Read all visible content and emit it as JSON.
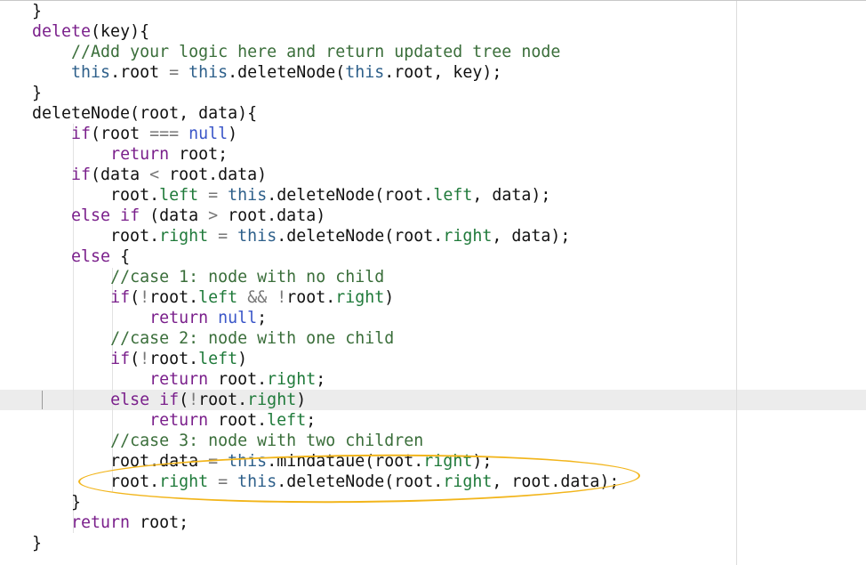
{
  "editor": {
    "lines": [
      [
        {
          "t": "}",
          "c": ""
        }
      ],
      [
        {
          "t": "delete",
          "c": "kw"
        },
        {
          "t": "(key){",
          "c": ""
        }
      ],
      [
        {
          "t": "    ",
          "c": ""
        },
        {
          "t": "//Add your logic here and return updated tree node",
          "c": "cm"
        }
      ],
      [
        {
          "t": "    ",
          "c": ""
        },
        {
          "t": "this",
          "c": "th"
        },
        {
          "t": ".root ",
          "c": ""
        },
        {
          "t": "=",
          "c": "op"
        },
        {
          "t": " ",
          "c": ""
        },
        {
          "t": "this",
          "c": "th"
        },
        {
          "t": ".deleteNode(",
          "c": ""
        },
        {
          "t": "this",
          "c": "th"
        },
        {
          "t": ".root, key);",
          "c": ""
        }
      ],
      [
        {
          "t": "}",
          "c": ""
        }
      ],
      [
        {
          "t": "deleteNode(root, data){",
          "c": ""
        }
      ],
      [
        {
          "t": "    ",
          "c": ""
        },
        {
          "t": "if",
          "c": "kw"
        },
        {
          "t": "(root ",
          "c": ""
        },
        {
          "t": "===",
          "c": "op"
        },
        {
          "t": " ",
          "c": ""
        },
        {
          "t": "null",
          "c": "kb"
        },
        {
          "t": ")",
          "c": ""
        }
      ],
      [
        {
          "t": "        ",
          "c": ""
        },
        {
          "t": "return",
          "c": "kw"
        },
        {
          "t": " root;",
          "c": ""
        }
      ],
      [
        {
          "t": "    ",
          "c": ""
        },
        {
          "t": "if",
          "c": "kw"
        },
        {
          "t": "(data ",
          "c": ""
        },
        {
          "t": "<",
          "c": "op"
        },
        {
          "t": " root.data)",
          "c": ""
        }
      ],
      [
        {
          "t": "        root.",
          "c": ""
        },
        {
          "t": "left",
          "c": "pr"
        },
        {
          "t": " ",
          "c": ""
        },
        {
          "t": "=",
          "c": "op"
        },
        {
          "t": " ",
          "c": ""
        },
        {
          "t": "this",
          "c": "th"
        },
        {
          "t": ".deleteNode(root.",
          "c": ""
        },
        {
          "t": "left",
          "c": "pr"
        },
        {
          "t": ", data);",
          "c": ""
        }
      ],
      [
        {
          "t": "    ",
          "c": ""
        },
        {
          "t": "else if",
          "c": "kw"
        },
        {
          "t": " (data ",
          "c": ""
        },
        {
          "t": ">",
          "c": "op"
        },
        {
          "t": " root.data)",
          "c": ""
        }
      ],
      [
        {
          "t": "        root.",
          "c": ""
        },
        {
          "t": "right",
          "c": "pr"
        },
        {
          "t": " ",
          "c": ""
        },
        {
          "t": "=",
          "c": "op"
        },
        {
          "t": " ",
          "c": ""
        },
        {
          "t": "this",
          "c": "th"
        },
        {
          "t": ".deleteNode(root.",
          "c": ""
        },
        {
          "t": "right",
          "c": "pr"
        },
        {
          "t": ", data);",
          "c": ""
        }
      ],
      [
        {
          "t": "    ",
          "c": ""
        },
        {
          "t": "else",
          "c": "kw"
        },
        {
          "t": " {",
          "c": ""
        }
      ],
      [
        {
          "t": "        ",
          "c": ""
        },
        {
          "t": "//case 1: node with no child",
          "c": "cm"
        }
      ],
      [
        {
          "t": "        ",
          "c": ""
        },
        {
          "t": "if",
          "c": "kw"
        },
        {
          "t": "(",
          "c": ""
        },
        {
          "t": "!",
          "c": "op"
        },
        {
          "t": "root.",
          "c": ""
        },
        {
          "t": "left",
          "c": "pr"
        },
        {
          "t": " ",
          "c": ""
        },
        {
          "t": "&&",
          "c": "op"
        },
        {
          "t": " ",
          "c": ""
        },
        {
          "t": "!",
          "c": "op"
        },
        {
          "t": "root.",
          "c": ""
        },
        {
          "t": "right",
          "c": "pr"
        },
        {
          "t": ")",
          "c": ""
        }
      ],
      [
        {
          "t": "            ",
          "c": ""
        },
        {
          "t": "return",
          "c": "kw"
        },
        {
          "t": " ",
          "c": ""
        },
        {
          "t": "null",
          "c": "kb"
        },
        {
          "t": ";",
          "c": ""
        }
      ],
      [
        {
          "t": "        ",
          "c": ""
        },
        {
          "t": "//case 2: node with one child",
          "c": "cm"
        }
      ],
      [
        {
          "t": "        ",
          "c": ""
        },
        {
          "t": "if",
          "c": "kw"
        },
        {
          "t": "(",
          "c": ""
        },
        {
          "t": "!",
          "c": "op"
        },
        {
          "t": "root.",
          "c": ""
        },
        {
          "t": "left",
          "c": "pr"
        },
        {
          "t": ")",
          "c": ""
        }
      ],
      [
        {
          "t": "            ",
          "c": ""
        },
        {
          "t": "return",
          "c": "kw"
        },
        {
          "t": " root.",
          "c": ""
        },
        {
          "t": "right",
          "c": "pr"
        },
        {
          "t": ";",
          "c": ""
        }
      ],
      [
        {
          "t": "        ",
          "c": ""
        },
        {
          "t": "else if",
          "c": "kw"
        },
        {
          "t": "(",
          "c": ""
        },
        {
          "t": "!",
          "c": "op"
        },
        {
          "t": "root.",
          "c": ""
        },
        {
          "t": "right",
          "c": "pr"
        },
        {
          "t": ")",
          "c": ""
        }
      ],
      [
        {
          "t": "            ",
          "c": ""
        },
        {
          "t": "return",
          "c": "kw"
        },
        {
          "t": " root.",
          "c": ""
        },
        {
          "t": "left",
          "c": "pr"
        },
        {
          "t": ";",
          "c": ""
        }
      ],
      [
        {
          "t": "        ",
          "c": ""
        },
        {
          "t": "//case 3: node with two children",
          "c": "cm"
        }
      ],
      [
        {
          "t": "        root.data ",
          "c": ""
        },
        {
          "t": "=",
          "c": "op"
        },
        {
          "t": " ",
          "c": ""
        },
        {
          "t": "this",
          "c": "th"
        },
        {
          "t": ".mindataue(root.",
          "c": ""
        },
        {
          "t": "right",
          "c": "pr"
        },
        {
          "t": ");",
          "c": ""
        }
      ],
      [
        {
          "t": "        root.",
          "c": ""
        },
        {
          "t": "right",
          "c": "pr"
        },
        {
          "t": " ",
          "c": ""
        },
        {
          "t": "=",
          "c": "op"
        },
        {
          "t": " ",
          "c": ""
        },
        {
          "t": "this",
          "c": "th"
        },
        {
          "t": ".deleteNode(root.",
          "c": ""
        },
        {
          "t": "right",
          "c": "pr"
        },
        {
          "t": ", root.data);",
          "c": ""
        }
      ],
      [
        {
          "t": "    }",
          "c": ""
        }
      ],
      [
        {
          "t": "    ",
          "c": ""
        },
        {
          "t": "return",
          "c": "kw"
        },
        {
          "t": " root;",
          "c": ""
        }
      ],
      [
        {
          "t": "}",
          "c": ""
        }
      ]
    ]
  },
  "colors": {
    "keyword": "#7a1f8b",
    "literal": "#3a56c8",
    "this": "#2d5f8a",
    "comment": "#3a6e3a",
    "property": "#1f7a3a",
    "operator": "#777777",
    "annotation_ellipse": "#f2b51b",
    "current_line": "#ececec"
  }
}
